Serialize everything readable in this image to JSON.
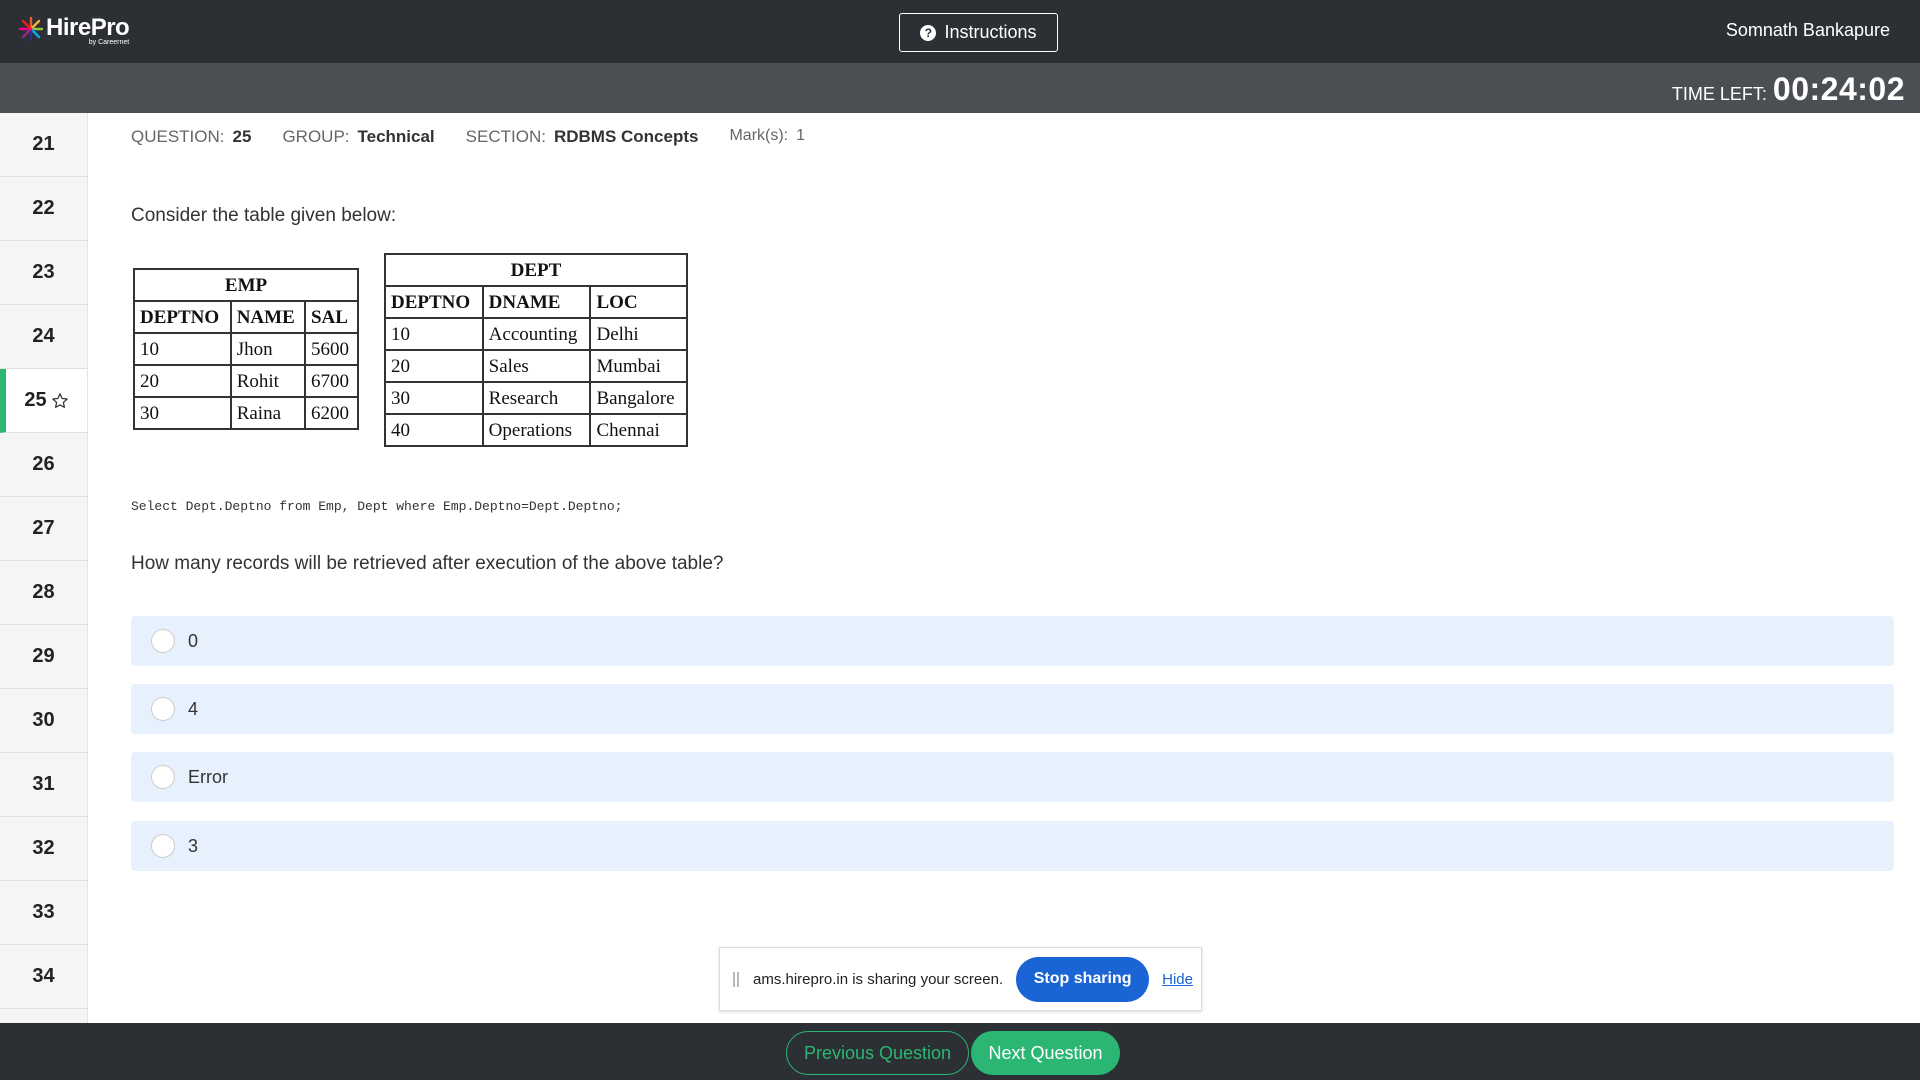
{
  "header": {
    "logo_name": "HirePro",
    "logo_sub": "by Careernet",
    "instructions_label": "Instructions",
    "username": "Somnath Bankapure"
  },
  "timer": {
    "label": "TIME LEFT:",
    "value": "00:24:02"
  },
  "sidebar": {
    "items": [
      {
        "label": "21"
      },
      {
        "label": "22"
      },
      {
        "label": "23"
      },
      {
        "label": "24"
      },
      {
        "label": "25",
        "active": true,
        "starred": true
      },
      {
        "label": "26"
      },
      {
        "label": "27"
      },
      {
        "label": "28"
      },
      {
        "label": "29"
      },
      {
        "label": "30"
      },
      {
        "label": "31"
      },
      {
        "label": "32"
      },
      {
        "label": "33"
      },
      {
        "label": "34"
      }
    ]
  },
  "question_meta": {
    "question_label": "QUESTION:",
    "question_value": "25",
    "group_label": "GROUP:",
    "group_value": "Technical",
    "section_label": "SECTION:",
    "section_value": "RDBMS Concepts",
    "marks_label": "Mark(s):",
    "marks_value": "1"
  },
  "question": {
    "prompt": "Consider the table given below:",
    "emp_table": {
      "title": "EMP",
      "headers": [
        "DEPTNO",
        "NAME",
        "SAL"
      ],
      "rows": [
        [
          "10",
          "Jhon",
          "5600"
        ],
        [
          "20",
          "Rohit",
          "6700"
        ],
        [
          "30",
          "Raina",
          "6200"
        ]
      ]
    },
    "dept_table": {
      "title": "DEPT",
      "headers": [
        "DEPTNO",
        "DNAME",
        "LOC"
      ],
      "rows": [
        [
          "10",
          "Accounting",
          "Delhi"
        ],
        [
          "20",
          "Sales",
          "Mumbai"
        ],
        [
          "30",
          "Research",
          "Bangalore"
        ],
        [
          "40",
          "Operations",
          "Chennai"
        ]
      ]
    },
    "sql": "Select Dept.Deptno from Emp, Dept where Emp.Deptno=Dept.Deptno;",
    "text": "How many records will be retrieved after execution of the above table?",
    "options": [
      {
        "label": "0"
      },
      {
        "label": "4"
      },
      {
        "label": "Error"
      },
      {
        "label": "3"
      }
    ]
  },
  "share_bar": {
    "text": "ams.hirepro.in is sharing your screen.",
    "stop_label": "Stop sharing",
    "hide_label": "Hide"
  },
  "footer": {
    "prev_label": "Previous Question",
    "next_label": "Next Question"
  },
  "colors": {
    "header_bg": "#2c2f33",
    "timer_bg": "#4b4f54",
    "accent_green": "#2bb673",
    "option_bg": "#e7f1fe",
    "share_blue": "#1a64d6"
  }
}
